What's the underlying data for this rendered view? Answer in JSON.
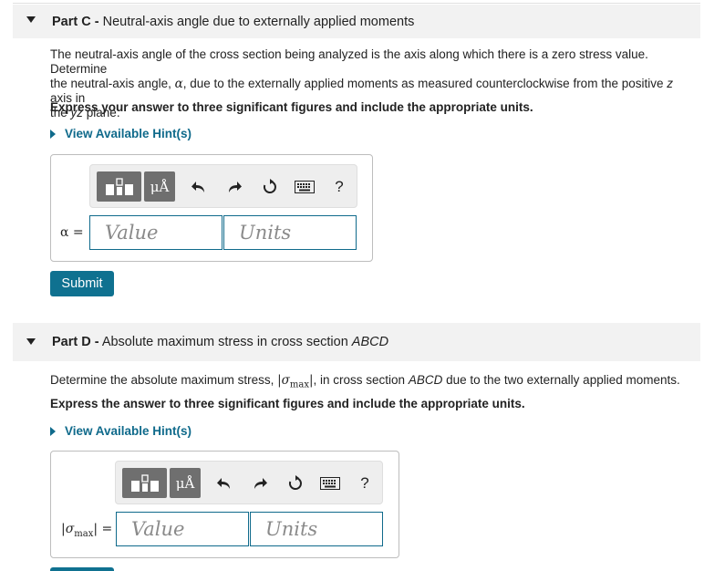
{
  "partC": {
    "label": "Part C -",
    "title": "Neutral-axis angle due to externally applied moments",
    "desc_line1": "The neutral-axis angle of the cross section being analyzed is the axis along which there is a zero stress value. Determine",
    "desc_line2_a": "the neutral-axis angle, ",
    "alpha": "α",
    "desc_line2_b": ", due to the externally applied moments as measured counterclockwise from the positive ",
    "z": "z",
    "desc_line2_c": " axis in",
    "desc_line3_a": "the ",
    "yz": "yz",
    "desc_line3_b": " plane.",
    "instruction": "Express your answer to three significant figures and include the appropriate units.",
    "hint": "View Available Hint(s)",
    "toolbar": {
      "mu_label": "μÅ",
      "help": "?"
    },
    "variable_label": "α =",
    "value_placeholder": "Value",
    "units_placeholder": "Units",
    "submit": "Submit"
  },
  "partD": {
    "label": "Part D -",
    "title_a": "Absolute maximum stress in cross section ",
    "title_b": "ABCD",
    "desc_a": "Determine the absolute maximum stress, ",
    "desc_sym": "|σmax|",
    "desc_b": ", in cross section ",
    "desc_c": "ABCD",
    "desc_d": " due to the two externally applied moments.",
    "instruction": "Express the answer to three significant figures and include the appropriate units.",
    "hint": "View Available Hint(s)",
    "toolbar": {
      "mu_label": "μÅ",
      "help": "?"
    },
    "variable_label_sigma": "σ",
    "variable_label_sub": "max",
    "variable_label_eq": "=",
    "value_placeholder": "Value",
    "units_placeholder": "Units"
  },
  "icons": [
    "templates-icon",
    "undo-icon",
    "redo-icon",
    "reset-icon",
    "keyboard-icon",
    "help-icon",
    "collapse-caret-icon",
    "expand-hint-icon"
  ]
}
